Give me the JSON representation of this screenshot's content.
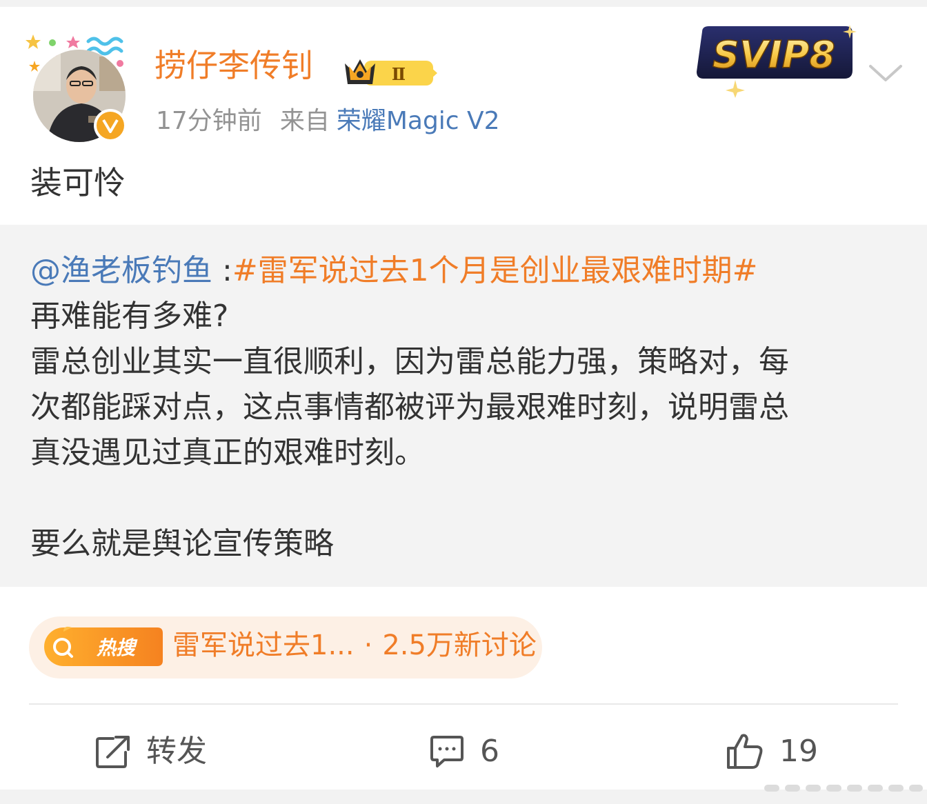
{
  "post": {
    "author": "捞仔李传钊",
    "level_badge": "Ⅱ",
    "time": "17分钟前",
    "source_prefix": "来自",
    "device": "荣耀Magic V2",
    "vip_badge": "SVIP8",
    "text": "装可怜"
  },
  "repost": {
    "mention": "@渔老板钓鱼",
    "separator": " :",
    "hashtag": "#雷军说过去1个月是创业最艰难时期#",
    "lines": [
      "再难能有多难?",
      "雷总创业其实一直很顺利，因为雷总能力强，策略对，每",
      "次都能踩对点，这点事情都被评为最艰难时刻，说明雷总",
      "真没遇见过真正的艰难时刻。"
    ],
    "last_line": "要么就是舆论宣传策略"
  },
  "hot_search": {
    "icon_label": "热搜",
    "topic": "雷军说过去1...",
    "dot": "·",
    "discussion": "2.5万新讨论"
  },
  "actions": {
    "repost_label": "转发",
    "comment_count": "6",
    "like_count": "19"
  },
  "colors": {
    "accent_orange": "#f07d28",
    "link_blue": "#4a7ab8",
    "meta_gray": "#939393",
    "repost_bg": "#f3f3f3",
    "hot_bg": "#fdf0e5"
  }
}
